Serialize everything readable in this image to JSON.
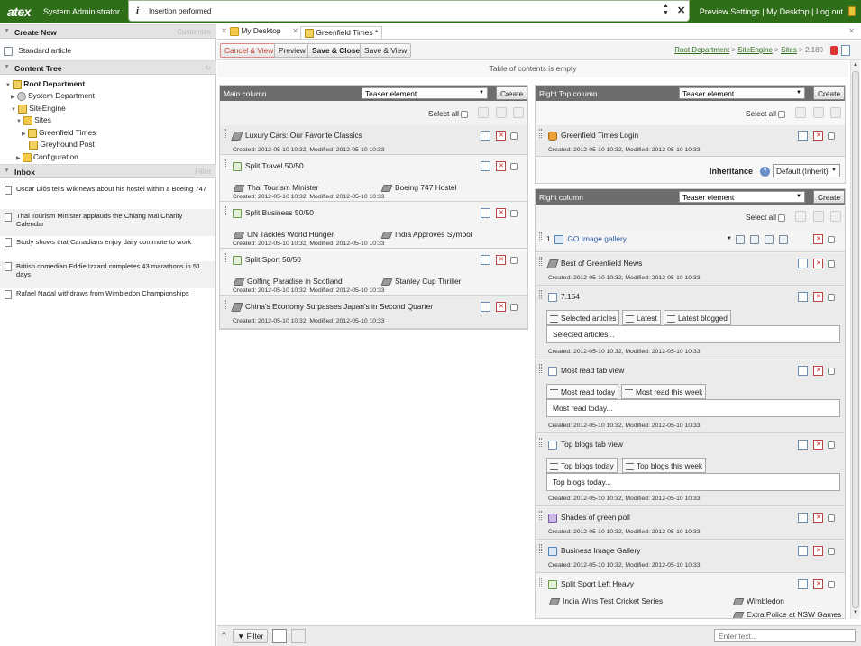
{
  "header": {
    "logo": "atex",
    "user": "System Administrator",
    "notice_icon": "i",
    "notice": "Insertion performed",
    "links": [
      "Preview Settings",
      "My Desktop",
      "Log out"
    ],
    "separator": " | "
  },
  "sidebar": {
    "create_new": {
      "title": "Create New",
      "action": "Customize",
      "items": [
        "Standard article"
      ]
    },
    "content_tree": {
      "title": "Content Tree",
      "nodes": [
        "Root Department",
        "System Department",
        "SiteEngine",
        "Sites",
        "Greenfield Times",
        "Greyhound Post",
        "Configuration"
      ]
    },
    "inbox": {
      "title": "Inbox",
      "action": "Filter",
      "items": [
        "Oscar Diôs tells Wikinews about his hostel within a Boeing 747",
        "Thai Tourism Minister applauds the Chiang Mai Charity Calendar",
        "Study shows that Canadians enjoy daily commute to work",
        "British comedian Eddie Izzard completes 43 marathons in 51 days",
        "Rafael Nadal withdraws from Wimbledon Championships"
      ]
    }
  },
  "tabs": {
    "desktop": "My Desktop",
    "current": "Greenfield Times",
    "modified_mark": "*"
  },
  "actions": {
    "cancel_view": "Cancel & View",
    "preview": "Preview",
    "save_close": "Save & Close",
    "save_view": "Save & View"
  },
  "breadcrumb": {
    "items": [
      "Root Department",
      "SiteEngine",
      "Sites"
    ],
    "sep": " > ",
    "id": " > 2.180"
  },
  "toc_empty": "Table of contents is empty",
  "common": {
    "select_all": "Select all",
    "teaser": "Teaser element",
    "create": "Create",
    "meta": "Created: 2012-05-10 10:32, Modified: 2012-05-10 10:33"
  },
  "main_column": {
    "title": "Main column",
    "items": [
      {
        "title": "Luxury Cars: Our Favorite Classics"
      },
      {
        "title": "Split Travel 50/50",
        "left": "Thai Tourism Minister",
        "right": "Boeing 747 Hostel"
      },
      {
        "title": "Split Business 50/50",
        "left": "UN Tackles World Hunger",
        "right": "India Approves Symbol"
      },
      {
        "title": "Split Sport 50/50",
        "left": "Golfing Paradise in Scotland",
        "right": "Stanley Cup Thriller"
      },
      {
        "title": "China's Economy Surpasses Japan's in Second Quarter"
      }
    ]
  },
  "right_top": {
    "title": "Right Top column",
    "items": [
      {
        "title": "Greenfield Times Login"
      }
    ],
    "inheritance_label": "Inheritance",
    "inheritance_help": "?",
    "inheritance_value": "Default (Inherit)"
  },
  "right_column": {
    "title": "Right column",
    "items": [
      {
        "number": "1.",
        "title": "GO Image gallery"
      },
      {
        "title": "Best of Greenfield News"
      },
      {
        "title": "7.154",
        "tabs": [
          "Selected articles",
          "Latest",
          "Latest blogged"
        ],
        "body": "Selected articles..."
      },
      {
        "title": "Most read tab view",
        "tabs": [
          "Most read today",
          "Most read this week"
        ],
        "body": "Most read today..."
      },
      {
        "title": "Top blogs tab view",
        "tabs": [
          "Top blogs today",
          "Top blogs this week"
        ],
        "body": "Top blogs today..."
      },
      {
        "title": "Shades of green poll"
      },
      {
        "title": "Business Image Gallery"
      },
      {
        "title": "Split Sport Left Heavy",
        "left": "India Wins Test Cricket Series",
        "right": "Wimbledon",
        "right2": "Extra Police at NSW Games"
      }
    ]
  },
  "bottom": {
    "filter": "Filter",
    "search_placeholder": "Enter text..."
  }
}
